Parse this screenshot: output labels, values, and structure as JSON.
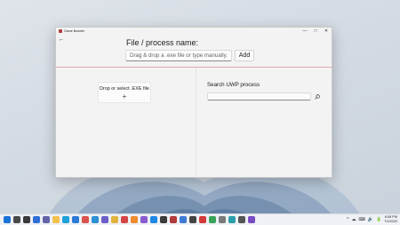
{
  "window": {
    "title": "Game Booster",
    "controls": [
      "—",
      "□",
      "✕"
    ]
  },
  "main": {
    "heading": "File / process name:",
    "path_input_placeholder": "Drag & drop a .exe file or type manually.",
    "add_label": "Add",
    "drop_zone_label": "Drop or select .EXE file",
    "drop_zone_plus": "+",
    "uwp_heading": "Search UWP process",
    "uwp_search_value": ""
  },
  "taskbar": {
    "icons": [
      {
        "name": "windows-start-icon",
        "color": "#1a73d9"
      },
      {
        "name": "search-icon",
        "color": "#4a4a4a"
      },
      {
        "name": "task-view-icon",
        "color": "#3a3a3a"
      },
      {
        "name": "widgets-icon",
        "color": "#2f6fd6"
      },
      {
        "name": "chat-icon",
        "color": "#6264a7"
      },
      {
        "name": "file-explorer-icon",
        "color": "#f2c14e"
      },
      {
        "name": "edge-icon",
        "color": "#1fa0d8"
      },
      {
        "name": "store-icon",
        "color": "#2b7bd6"
      },
      {
        "name": "mail-icon",
        "color": "#d9534f"
      },
      {
        "name": "photos-icon",
        "color": "#2d8fd5"
      },
      {
        "name": "teams-icon",
        "color": "#6b5fc7"
      },
      {
        "name": "chrome-icon",
        "color": "#e2b33c"
      },
      {
        "name": "app-icon-red",
        "color": "#d64545"
      },
      {
        "name": "app-icon-orange",
        "color": "#f08c2e"
      },
      {
        "name": "visual-studio-icon",
        "color": "#8a5bd1"
      },
      {
        "name": "vscode-icon",
        "color": "#1e88e5"
      },
      {
        "name": "terminal-icon",
        "color": "#3b3b3b"
      },
      {
        "name": "game-booster-icon",
        "color": "#b13a3a"
      },
      {
        "name": "app-icon-blue",
        "color": "#3d7bd6"
      },
      {
        "name": "app-icon-dark",
        "color": "#444444"
      },
      {
        "name": "app-icon-red2",
        "color": "#d23a3a"
      },
      {
        "name": "app-icon-green",
        "color": "#3aa35a"
      },
      {
        "name": "app-icon-gray",
        "color": "#7a7a7a"
      },
      {
        "name": "app-icon-teal",
        "color": "#2a9fa8"
      },
      {
        "name": "settings-icon",
        "color": "#555555"
      },
      {
        "name": "app-icon-purple",
        "color": "#7b4cc4"
      }
    ],
    "clock_time": "6:08 PM",
    "clock_date": "7/1/2022",
    "tray_glyphs": [
      "^",
      "☁",
      "⌨",
      "🔊",
      "🔋"
    ]
  }
}
